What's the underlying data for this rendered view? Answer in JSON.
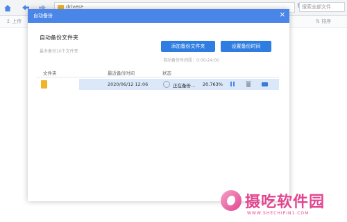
{
  "toolbar": {
    "address_path": "drives",
    "search_placeholder": "搜索全部文件",
    "upload_label": "上传",
    "sort_label": "排序"
  },
  "dialog": {
    "title": "自动备份",
    "close_label": "×",
    "section_title": "自动备份文件夹",
    "hint": "最多备份10个文件夹",
    "add_button": "添加备份文件夹",
    "time_button": "设置备份时间",
    "time_range": "自动备份时间段：0:00-24:00",
    "columns": [
      "文件夹",
      "最近备份时间",
      "状态"
    ],
    "rows": [
      {
        "date": "2020/06/12  12:06",
        "status": "正在备份...",
        "percent": "20.763%"
      }
    ]
  },
  "watermark": {
    "brand": "摄吃软件园",
    "url": "WWW.SHECHIPIN1.COM"
  },
  "colors": {
    "accent": "#4a86e8",
    "button": "#2f7de1",
    "selected_row": "#dbe8fa",
    "watermark": "#e2468f"
  }
}
